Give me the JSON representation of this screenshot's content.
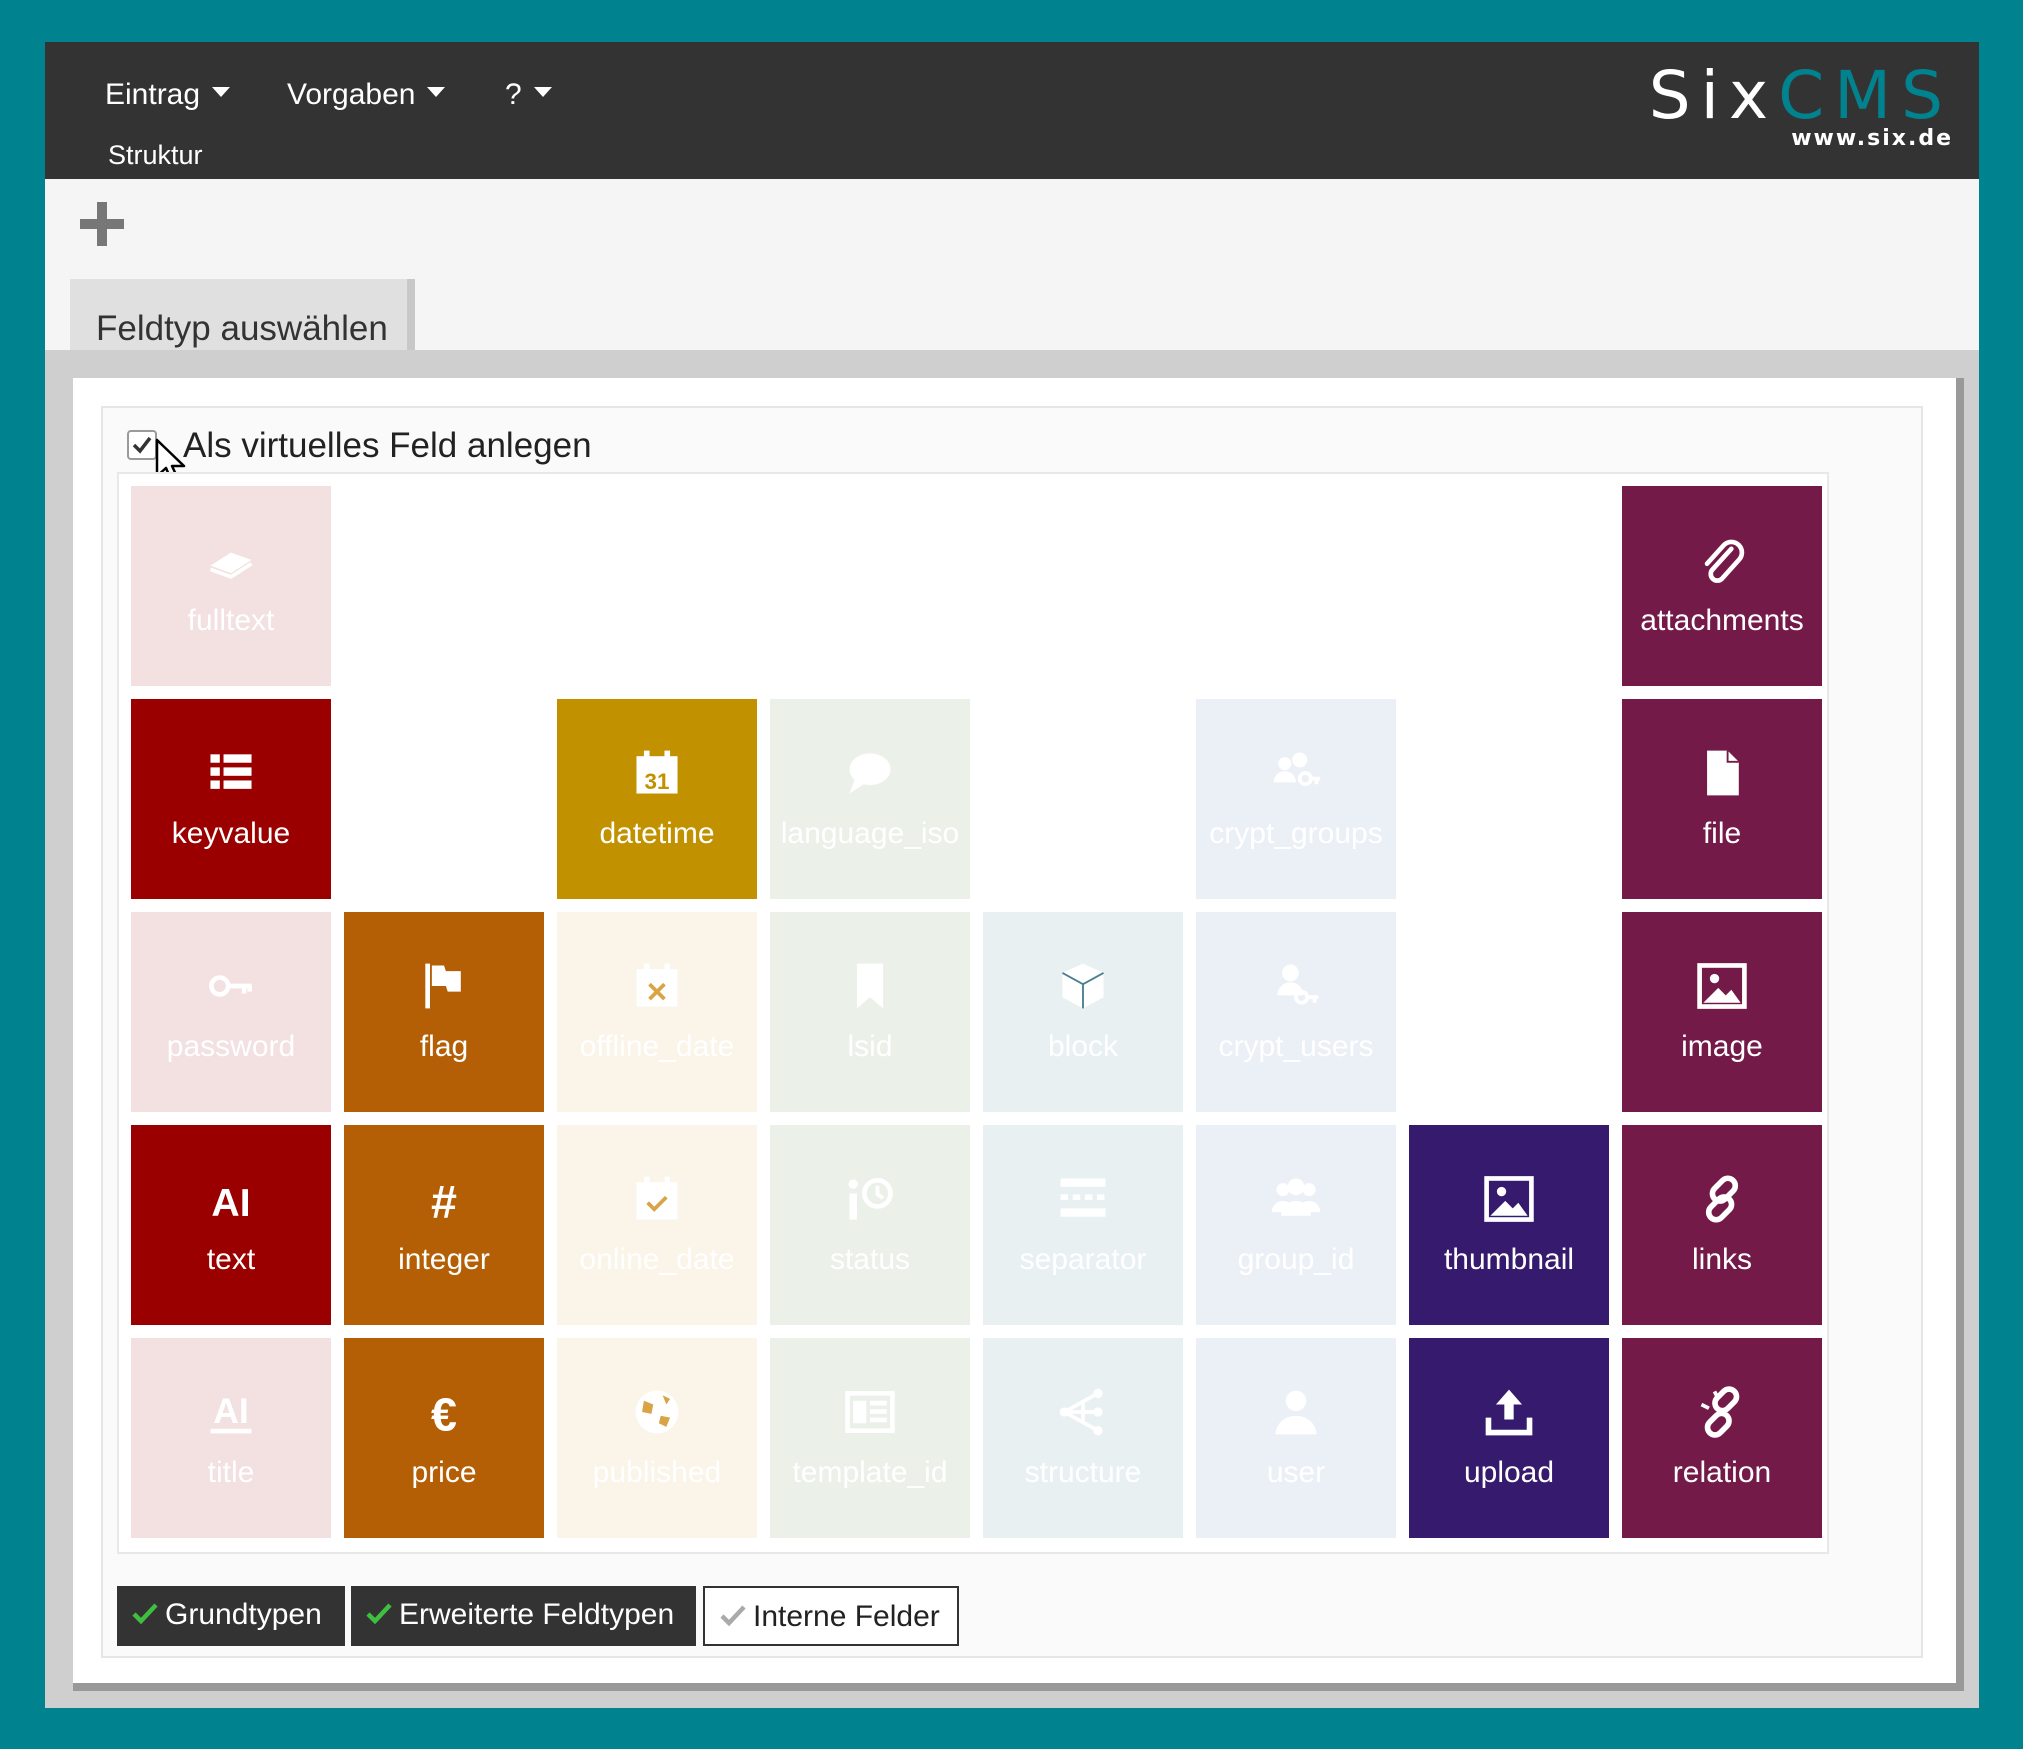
{
  "menu": {
    "items": [
      {
        "label": "Eintrag"
      },
      {
        "label": "Vorgaben"
      },
      {
        "label": "?"
      }
    ],
    "sub_item": "Struktur"
  },
  "logo": {
    "six": "Six",
    "cms": "CMS",
    "url": "www.six.de"
  },
  "tab": {
    "label": "Feldtyp auswählen"
  },
  "virtual_field": {
    "label": "Als virtuelles Feld anlegen",
    "checked": true
  },
  "fields": [
    {
      "id": "fulltext",
      "label": "fulltext",
      "icon": "book-icon",
      "color": "#9b0000",
      "active": false
    },
    {
      "id": "attachments",
      "label": "attachments",
      "icon": "paperclip-icon",
      "color": "#741a48",
      "active": true
    },
    {
      "id": "keyvalue",
      "label": "keyvalue",
      "icon": "list-icon",
      "color": "#9b0000",
      "active": true
    },
    {
      "id": "datetime",
      "label": "datetime",
      "icon": "calendar-icon",
      "color": "#c29100",
      "active": true
    },
    {
      "id": "language_iso",
      "label": "language_iso",
      "icon": "speech-bubble-icon",
      "color": "#5a8a4a",
      "active": false
    },
    {
      "id": "crypt_groups",
      "label": "crypt_groups",
      "icon": "users-key-icon",
      "color": "#5a80b8",
      "active": false
    },
    {
      "id": "file",
      "label": "file",
      "icon": "file-icon",
      "color": "#741a48",
      "active": true
    },
    {
      "id": "password",
      "label": "password",
      "icon": "key-icon",
      "color": "#9b0000",
      "active": false
    },
    {
      "id": "flag",
      "label": "flag",
      "icon": "flag-icon",
      "color": "#b45f06",
      "active": true
    },
    {
      "id": "offline_date",
      "label": "offline_date",
      "icon": "calendar-x-icon",
      "color": "#d8a445",
      "active": false
    },
    {
      "id": "lsid",
      "label": "lsid",
      "icon": "bookmark-icon",
      "color": "#5a8a4a",
      "active": false
    },
    {
      "id": "block",
      "label": "block",
      "icon": "cube-icon",
      "color": "#4a7f92",
      "active": false
    },
    {
      "id": "crypt_users",
      "label": "crypt_users",
      "icon": "user-key-icon",
      "color": "#5a80b8",
      "active": false
    },
    {
      "id": "image",
      "label": "image",
      "icon": "image-icon",
      "color": "#741a48",
      "active": true
    },
    {
      "id": "text",
      "label": "text",
      "icon": "text-ai-icon",
      "color": "#9b0000",
      "active": true
    },
    {
      "id": "integer",
      "label": "integer",
      "icon": "hash-icon",
      "color": "#b45f06",
      "active": true
    },
    {
      "id": "online_date",
      "label": "online_date",
      "icon": "calendar-check-icon",
      "color": "#d8a445",
      "active": false
    },
    {
      "id": "status",
      "label": "status",
      "icon": "status-icon",
      "color": "#5a8a4a",
      "active": false
    },
    {
      "id": "separator",
      "label": "separator",
      "icon": "separator-icon",
      "color": "#4a7f92",
      "active": false
    },
    {
      "id": "group_id",
      "label": "group_id",
      "icon": "users-icon",
      "color": "#5a80b8",
      "active": false
    },
    {
      "id": "thumbnail",
      "label": "thumbnail",
      "icon": "image-icon",
      "color": "#361a6e",
      "active": true
    },
    {
      "id": "links",
      "label": "links",
      "icon": "link-icon",
      "color": "#741a48",
      "active": true
    },
    {
      "id": "title",
      "label": "title",
      "icon": "text-ai-underline-icon",
      "color": "#9b0000",
      "active": false
    },
    {
      "id": "price",
      "label": "price",
      "icon": "euro-icon",
      "color": "#b45f06",
      "active": true
    },
    {
      "id": "published",
      "label": "published",
      "icon": "globe-icon",
      "color": "#d8a445",
      "active": false
    },
    {
      "id": "template_id",
      "label": "template_id",
      "icon": "template-icon",
      "color": "#5a8a4a",
      "active": false
    },
    {
      "id": "structure",
      "label": "structure",
      "icon": "sitemap-icon",
      "color": "#4a7f92",
      "active": false
    },
    {
      "id": "user",
      "label": "user",
      "icon": "user-icon",
      "color": "#5a80b8",
      "active": false
    },
    {
      "id": "upload",
      "label": "upload",
      "icon": "upload-icon",
      "color": "#361a6e",
      "active": true
    },
    {
      "id": "relation",
      "label": "relation",
      "icon": "unlink-icon",
      "color": "#741a48",
      "active": true
    }
  ],
  "filters": [
    {
      "label": "Grundtypen",
      "on": true
    },
    {
      "label": "Erweiterte Feldtypen",
      "on": true
    },
    {
      "label": "Interne Felder",
      "on": false
    }
  ],
  "colors": {
    "accent": "#00838f",
    "topbar": "#333333"
  }
}
